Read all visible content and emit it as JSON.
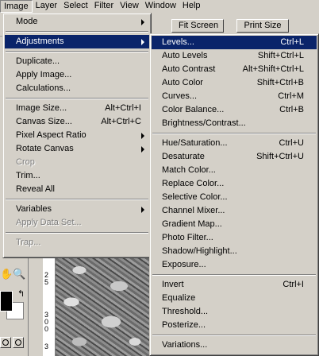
{
  "menubar": {
    "items": [
      "Image",
      "Layer",
      "Select",
      "Filter",
      "View",
      "Window",
      "Help"
    ]
  },
  "options_bar": {
    "fit_screen_label": "Fit Screen",
    "print_size_label": "Print Size"
  },
  "image_menu": {
    "items": [
      {
        "label": "Mode",
        "submenu": true
      },
      {
        "separator": true
      },
      {
        "label": "Adjustments",
        "submenu": true,
        "highlighted": true
      },
      {
        "separator": true
      },
      {
        "label": "Duplicate..."
      },
      {
        "label": "Apply Image..."
      },
      {
        "label": "Calculations..."
      },
      {
        "separator": true
      },
      {
        "label": "Image Size...",
        "shortcut": "Alt+Ctrl+I"
      },
      {
        "label": "Canvas Size...",
        "shortcut": "Alt+Ctrl+C"
      },
      {
        "label": "Pixel Aspect Ratio",
        "submenu": true
      },
      {
        "label": "Rotate Canvas",
        "submenu": true
      },
      {
        "label": "Crop",
        "disabled": true
      },
      {
        "label": "Trim..."
      },
      {
        "label": "Reveal All"
      },
      {
        "separator": true
      },
      {
        "label": "Variables",
        "submenu": true
      },
      {
        "label": "Apply Data Set...",
        "disabled": true
      },
      {
        "separator": true
      },
      {
        "label": "Trap...",
        "disabled": true
      }
    ]
  },
  "adjustments_menu": {
    "items": [
      {
        "label": "Levels...",
        "shortcut": "Ctrl+L",
        "highlighted": true
      },
      {
        "label": "Auto Levels",
        "shortcut": "Shift+Ctrl+L"
      },
      {
        "label": "Auto Contrast",
        "shortcut": "Alt+Shift+Ctrl+L"
      },
      {
        "label": "Auto Color",
        "shortcut": "Shift+Ctrl+B"
      },
      {
        "label": "Curves...",
        "shortcut": "Ctrl+M"
      },
      {
        "label": "Color Balance...",
        "shortcut": "Ctrl+B"
      },
      {
        "label": "Brightness/Contrast..."
      },
      {
        "separator": true
      },
      {
        "label": "Hue/Saturation...",
        "shortcut": "Ctrl+U"
      },
      {
        "label": "Desaturate",
        "shortcut": "Shift+Ctrl+U"
      },
      {
        "label": "Match Color..."
      },
      {
        "label": "Replace Color..."
      },
      {
        "label": "Selective Color..."
      },
      {
        "label": "Channel Mixer..."
      },
      {
        "label": "Gradient Map..."
      },
      {
        "label": "Photo Filter..."
      },
      {
        "label": "Shadow/Highlight..."
      },
      {
        "label": "Exposure..."
      },
      {
        "separator": true
      },
      {
        "label": "Invert",
        "shortcut": "Ctrl+I"
      },
      {
        "label": "Equalize"
      },
      {
        "label": "Threshold..."
      },
      {
        "label": "Posterize..."
      },
      {
        "separator": true
      },
      {
        "label": "Variations..."
      }
    ]
  },
  "ruler": {
    "ticks": [
      "2",
      "5",
      "3",
      "0",
      "0",
      "3"
    ]
  },
  "colors": {
    "menu_face": "#d4d0c8",
    "highlight": "#0a246a",
    "disabled_text": "#808080"
  }
}
